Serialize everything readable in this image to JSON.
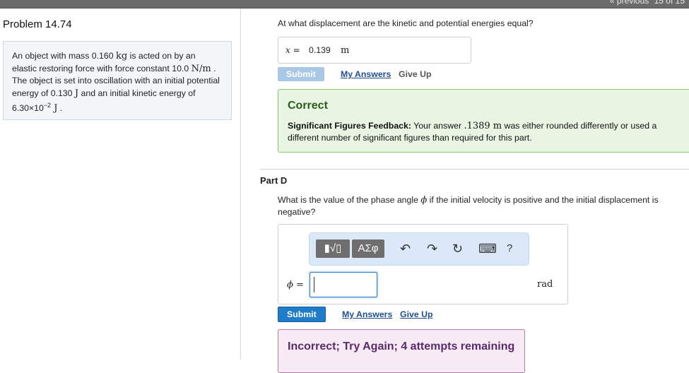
{
  "nav": {
    "previous": "« previous",
    "pages": "15 of 15"
  },
  "problem": {
    "title": "Problem 14.74",
    "text_1": "An object with mass 0.160 ",
    "unit_kg": "kg",
    "text_2": " is acted on by an elastic restoring force with force constant 10.0 ",
    "unit_nm": "N/m",
    "text_3": " . The object is set into oscillation with an initial potential energy of 0.130 ",
    "unit_j1": "J",
    "text_4": " and an initial kinetic energy of 6.30×10",
    "exp": "−2",
    "unit_j2": " J",
    "text_5": " ."
  },
  "part_c": {
    "question": "At what displacement are the kinetic and potential energies equal?",
    "var": "x =",
    "value": "0.139",
    "unit": "m",
    "submit": "Submit",
    "my_answers": "My Answers",
    "give_up": "Give Up",
    "feedback_title": "Correct",
    "feedback_label": "Significant Figures Feedback:",
    "feedback_text_1": " Your answer ",
    "feedback_value": ".1389 m",
    "feedback_text_2": " was either rounded differently or used a different number of significant figures than required for this part."
  },
  "part_d": {
    "title": "Part D",
    "question_1": "What is the value of the phase angle ",
    "phi": "ϕ",
    "question_2": " if the initial velocity is positive and the initial displacement is negative?",
    "toolbar": {
      "templates": "▮√▯",
      "symbols": "ΑΣφ",
      "undo": "↶",
      "redo": "↷",
      "reset": "↻",
      "keyboard": "⌨",
      "help": "?"
    },
    "var": "ϕ =",
    "unit": "rad",
    "submit": "Submit",
    "my_answers": "My Answers",
    "give_up": "Give Up",
    "incorrect": "Incorrect; Try Again; 4 attempts remaining"
  }
}
